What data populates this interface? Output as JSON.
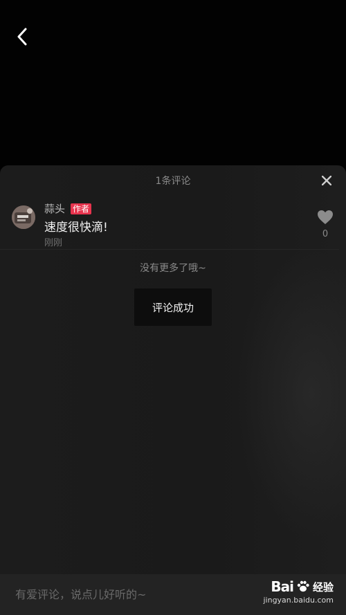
{
  "header": {
    "back_icon": "chevron-left-icon"
  },
  "sheet": {
    "comment_count": "1条评论",
    "close_icon": "close-icon"
  },
  "comment": {
    "author": "蒜头",
    "badge": "作者",
    "text": "速度很快滴!",
    "time": "刚刚",
    "like_icon": "heart-icon",
    "like_count": "0"
  },
  "list": {
    "end_text": "没有更多了哦~"
  },
  "toast": {
    "text": "评论成功"
  },
  "input": {
    "placeholder": "有爱评论，说点儿好听的~"
  },
  "watermark": {
    "brand": "Bai",
    "brand2": "经验",
    "url": "jingyan.baidu.com"
  },
  "colors": {
    "badge": "#e8344e",
    "sheet_bg": "#1c1c1c",
    "toast_bg": "#0d0d0d"
  }
}
